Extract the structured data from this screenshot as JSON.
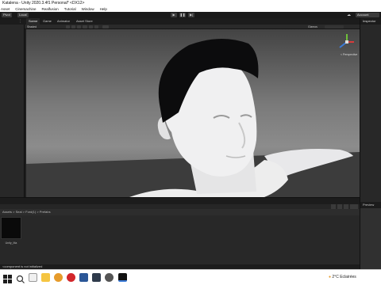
{
  "window": {
    "title": "Katalena - Unity 2020.3.4f1 Personal* <DX12>"
  },
  "menu": {
    "items": [
      "Asset",
      "Cinemachine",
      "Realfusion",
      "Tutorial",
      "Window",
      "Help"
    ]
  },
  "toolbar": {
    "left_buttons": [
      "Pivot",
      "Local"
    ],
    "right_buttons": [
      "Account"
    ]
  },
  "scene_view": {
    "tabs": [
      "Scene",
      "Game",
      "Animator",
      "Asset Store"
    ],
    "active_tab": "Scene",
    "shading_mode": "Shaded",
    "gizmos_label": "Gizmos",
    "projection_label": "< Perspective"
  },
  "inspector": {
    "tab_label": "Inspector",
    "preview_label": "Preview"
  },
  "project": {
    "breadcrumb": "Assets > Seal > Ford(1) > Prefabs",
    "asset_label": "Unity_Ma"
  },
  "status": {
    "message": "<component is not initialized"
  },
  "taskbar": {
    "weather_temp": "2°C",
    "weather_desc": "Eclairées",
    "colors": {
      "chrome": "#e69b2b",
      "opera": "#d2262b",
      "unity": "#111111",
      "word": "#2b5797"
    }
  }
}
